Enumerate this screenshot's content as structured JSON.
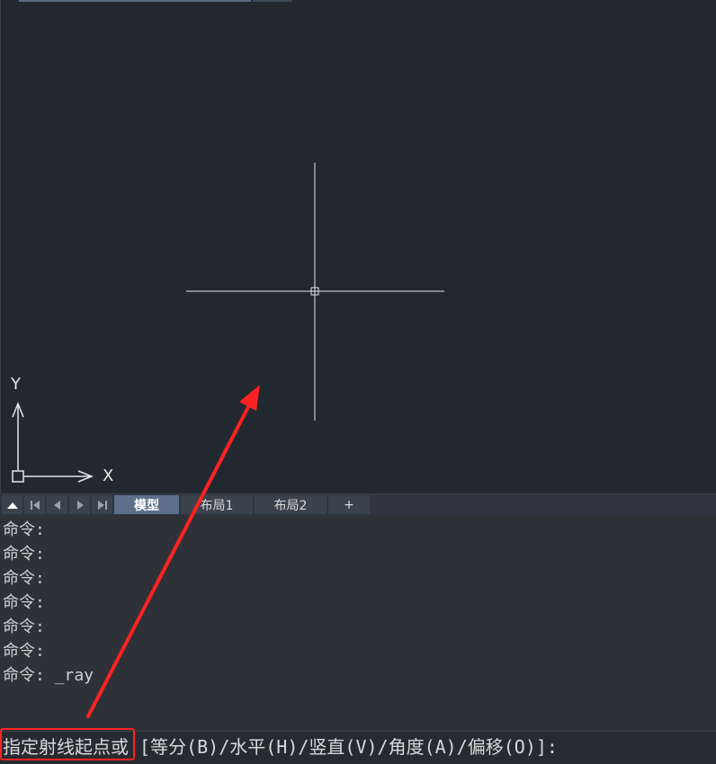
{
  "canvas": {
    "ucs": {
      "x_label": "X",
      "y_label": "Y"
    }
  },
  "tabs": {
    "nav_icons": [
      "collapse-up-icon",
      "first-page-icon",
      "prev-page-icon",
      "next-page-icon",
      "last-page-icon"
    ],
    "items": [
      {
        "label": "模型",
        "active": true
      },
      {
        "label": "布局1",
        "active": false
      },
      {
        "label": "布局2",
        "active": false
      },
      {
        "label": "+",
        "active": false
      }
    ]
  },
  "command_history": {
    "lines": [
      "命令:",
      "命令:",
      "命令:",
      "命令:",
      "命令:",
      "命令:",
      "命令: _ray"
    ]
  },
  "command_input": {
    "prompt": "指定射线起点或 [等分(B)/水平(H)/竖直(V)/角度(A)/偏移(O)]:"
  },
  "colors": {
    "canvas_bg": "#212830",
    "annotation": "#ff2222",
    "active_tab": "#5d6f8a"
  }
}
